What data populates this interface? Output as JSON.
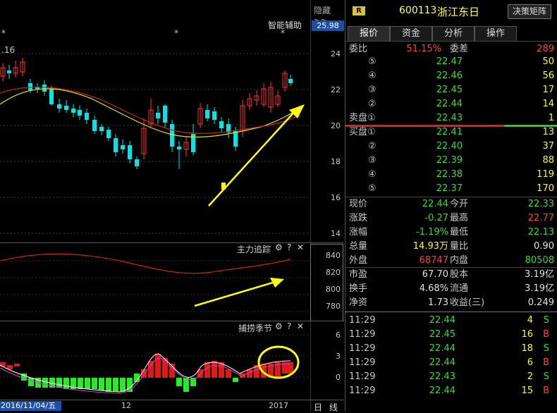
{
  "toolbar": {
    "hide_label": "隐藏>>",
    "price_badge": "25.98",
    "assist_label": "智能辅助",
    "prev_label": ".16",
    "stars": [
      "*",
      "*",
      "*"
    ]
  },
  "main_axis": [
    "24",
    "22",
    "20",
    "18",
    "16",
    "14"
  ],
  "indicator1": {
    "title": "主力追踪",
    "axis": [
      "840",
      "820",
      "800",
      "780"
    ]
  },
  "indicator2": {
    "title": "捕捞季节",
    "axis": [
      "6",
      "3",
      "0"
    ]
  },
  "xaxis": {
    "date": "2016/11/04/五",
    "mid": "12",
    "end": "2017",
    "mode": [
      "日",
      "线"
    ]
  },
  "header": {
    "badge": "R",
    "code": "600113",
    "name": "浙江东日",
    "button": "决策矩阵"
  },
  "tabs": [
    "报价",
    "资金",
    "分析",
    "操作"
  ],
  "weibi": {
    "label1": "委比",
    "val1": "51.15%",
    "label2": "委差",
    "val2": "289"
  },
  "asks": [
    {
      "n": "⑤",
      "price": "22.47",
      "vol": "50"
    },
    {
      "n": "④",
      "price": "22.46",
      "vol": "56"
    },
    {
      "n": "③",
      "price": "22.45",
      "vol": "17"
    },
    {
      "n": "②",
      "price": "22.44",
      "vol": "14"
    },
    {
      "n": "卖盘①",
      "price": "22.43",
      "vol": "1"
    }
  ],
  "bids": [
    {
      "n": "买盘①",
      "price": "22.41",
      "vol": "13"
    },
    {
      "n": "②",
      "price": "22.40",
      "vol": "37"
    },
    {
      "n": "③",
      "price": "22.39",
      "vol": "88"
    },
    {
      "n": "④",
      "price": "22.38",
      "vol": "119"
    },
    {
      "n": "⑤",
      "price": "22.37",
      "vol": "170"
    }
  ],
  "quote": [
    {
      "l1": "现价",
      "v1": "22.44",
      "c1": "green",
      "l2": "今开",
      "v2": "22.33",
      "c2": "green"
    },
    {
      "l1": "涨跌",
      "v1": "-0.27",
      "c1": "green",
      "l2": "最高",
      "v2": "22.77",
      "c2": "red"
    },
    {
      "l1": "涨幅",
      "v1": "-1.19%",
      "c1": "green",
      "l2": "最低",
      "v2": "22.13",
      "c2": "green"
    },
    {
      "l1": "总量",
      "v1": "14.93万",
      "c1": "yellow",
      "l2": "量比",
      "v2": "0.90",
      "c2": "white"
    },
    {
      "l1": "外盘",
      "v1": "68747",
      "c1": "red",
      "l2": "内盘",
      "v2": "80508",
      "c2": "green"
    },
    {
      "l1": "市盈",
      "v1": "67.70",
      "c1": "white",
      "l2": "股本",
      "v2": "3.19亿",
      "c2": "white"
    },
    {
      "l1": "换手",
      "v1": "4.68%",
      "c1": "white",
      "l2": "流通",
      "v2": "3.19亿",
      "c2": "white"
    },
    {
      "l1": "净资",
      "v1": "1.73",
      "c1": "white",
      "l2": "收益(三)",
      "v2": "0.249",
      "c2": "white"
    }
  ],
  "trades": [
    {
      "time": "11:29",
      "price": "22.44",
      "vol": "4",
      "side": "S"
    },
    {
      "time": "11:29",
      "price": "22.45",
      "vol": "16",
      "side": "B"
    },
    {
      "time": "11:29",
      "price": "22.44",
      "vol": "18",
      "side": "S"
    },
    {
      "time": "11:29",
      "price": "22.44",
      "vol": "6",
      "side": "B"
    },
    {
      "time": "11:29",
      "price": "22.43",
      "vol": "2",
      "side": "S"
    },
    {
      "time": "11:29",
      "price": "22.44",
      "vol": "15",
      "side": "B"
    }
  ],
  "colors": {
    "up": "#ff3333",
    "down": "#00e5e5",
    "ma_yellow": "#e6e600",
    "ma_red": "#cc2222",
    "arrow": "#ffff00",
    "bar_green": "#22ee22"
  }
}
